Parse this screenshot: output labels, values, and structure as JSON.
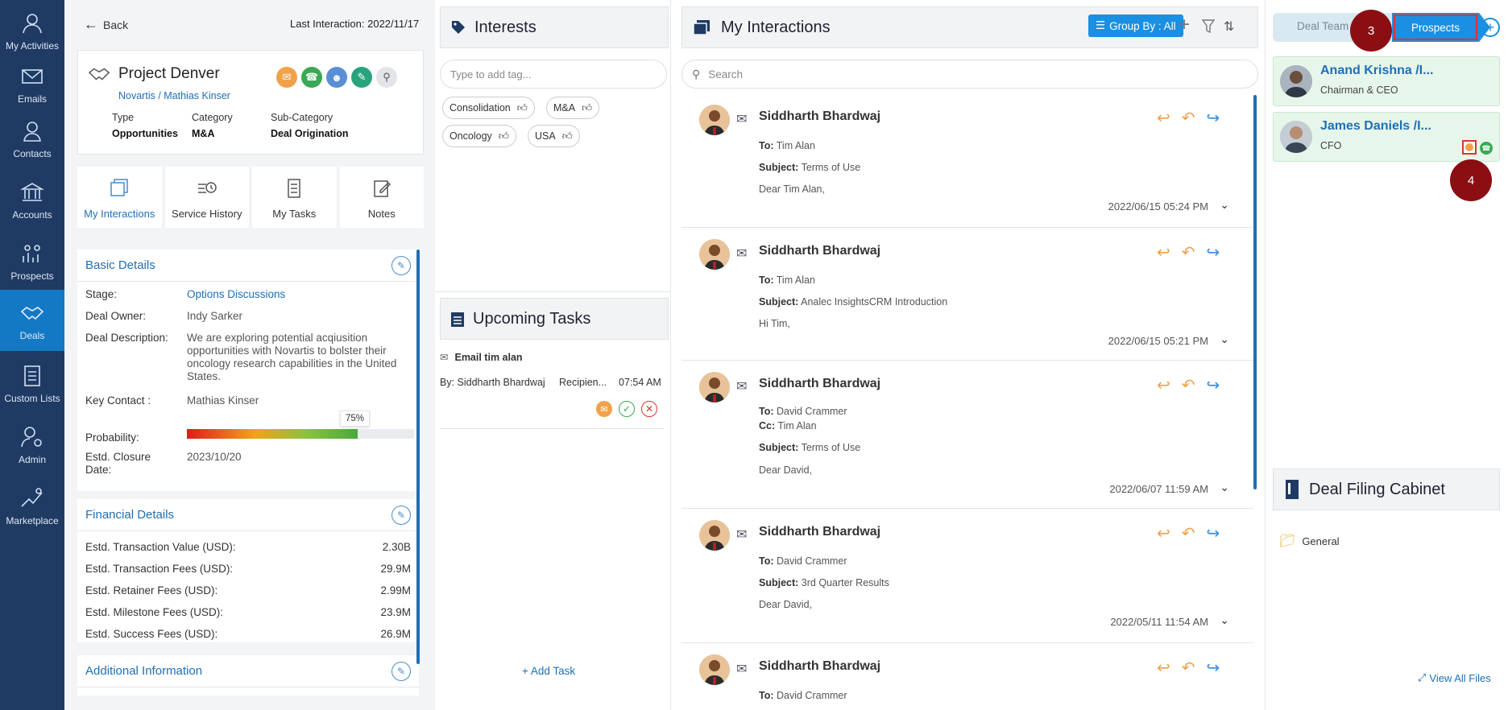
{
  "nav": [
    {
      "label": "My Activities",
      "icon": "user-icon"
    },
    {
      "label": "Emails",
      "icon": "mail-icon"
    },
    {
      "label": "Contacts",
      "icon": "contact-icon"
    },
    {
      "label": "Accounts",
      "icon": "bank-icon"
    },
    {
      "label": "Prospects",
      "icon": "prospects-icon"
    },
    {
      "label": "Deals",
      "icon": "handshake-icon",
      "active": true
    },
    {
      "label": "Custom Lists",
      "icon": "list-icon"
    },
    {
      "label": "Admin",
      "icon": "admin-icon"
    },
    {
      "label": "Marketplace",
      "icon": "marketplace-icon"
    }
  ],
  "header": {
    "back": "Back",
    "last_interaction": "Last Interaction: 2022/11/17"
  },
  "deal": {
    "title": "Project Denver",
    "subtitle": "Novartis / Mathias Kinser",
    "meta": {
      "type_label": "Type",
      "type_value": "Opportunities",
      "category_label": "Category",
      "category_value": "M&A",
      "subcategory_label": "Sub-Category",
      "subcategory_value": "Deal Origination"
    }
  },
  "tabs": [
    "My Interactions",
    "Service History",
    "My Tasks",
    "Notes"
  ],
  "basic": {
    "title": "Basic Details",
    "stage_label": "Stage:",
    "stage_value": "Options Discussions",
    "owner_label": "Deal Owner:",
    "owner_value": "Indy Sarker",
    "desc_label": "Deal Description:",
    "desc_value": "We are exploring potential acqiusition opportunities with Novartis to bolster their oncology research capabilities in the United States.",
    "contact_label": "Key Contact :",
    "contact_value": "Mathias Kinser",
    "prob_label": "Probability:",
    "prob_value": "75%",
    "prob_fraction": 0.75,
    "closure_label": "Estd. Closure Date:",
    "closure_value": "2023/10/20"
  },
  "financial": {
    "title": "Financial Details",
    "rows": [
      {
        "label": "Estd. Transaction Value (USD):",
        "value": "2.30B"
      },
      {
        "label": "Estd. Transaction Fees (USD):",
        "value": "29.9M"
      },
      {
        "label": "Estd. Retainer Fees (USD):",
        "value": "2.99M"
      },
      {
        "label": "Estd. Milestone Fees (USD):",
        "value": "23.9M"
      },
      {
        "label": "Estd. Success Fees (USD):",
        "value": "26.9M"
      }
    ]
  },
  "additional": {
    "title": "Additional Information"
  },
  "interests": {
    "title": "Interests",
    "placeholder": "Type to add tag...",
    "tags": [
      "Consolidation",
      "M&A",
      "Oncology",
      "USA"
    ]
  },
  "tasks": {
    "title": "Upcoming Tasks",
    "item_title": "Email tim alan",
    "item_by": "By: Siddharth Bhardwaj",
    "item_recipient": "Recipien...",
    "item_time": "07:54 AM",
    "add": "+ Add Task"
  },
  "interactions": {
    "title": "My Interactions",
    "group_by": "Group By : All",
    "search_placeholder": "Search",
    "items": [
      {
        "sender": "Siddharth Bhardwaj",
        "to": "Tim Alan",
        "cc": "",
        "subject": "Terms of Use",
        "body": "Dear Tim Alan,",
        "date": "2022/06/15 05:24 PM"
      },
      {
        "sender": "Siddharth Bhardwaj",
        "to": "Tim Alan",
        "cc": "",
        "subject": "Analec InsightsCRM Introduction",
        "body": "Hi Tim,",
        "date": "2022/06/15 05:21 PM"
      },
      {
        "sender": "Siddharth Bhardwaj",
        "to": "David Crammer",
        "cc": "Tim Alan",
        "subject": "Terms of Use",
        "body": "Dear David,",
        "date": "2022/06/07 11:59 AM"
      },
      {
        "sender": "Siddharth Bhardwaj",
        "to": "David Crammer",
        "cc": "",
        "subject": "3rd Quarter Results",
        "body": "Dear David,",
        "date": "2022/05/11 11:54 AM"
      },
      {
        "sender": "Siddharth Bhardwaj",
        "to": "David Crammer",
        "cc": "",
        "subject": "",
        "body": "",
        "date": ""
      }
    ],
    "to_label": "To:",
    "cc_label": "Cc:",
    "subject_label": "Subject:"
  },
  "prospects": {
    "tab_team": "Deal Team",
    "tab_prospects": "Prospects",
    "badge3": "3",
    "badge4": "4",
    "people": [
      {
        "name": "Anand Krishna /I...",
        "role": "Chairman & CEO"
      },
      {
        "name": "James Daniels /I...",
        "role": "CFO"
      }
    ]
  },
  "filing": {
    "title": "Deal Filing Cabinet",
    "folder": "General",
    "view_all": "View All Files"
  },
  "colors": {
    "nav_bg": "#1f3a63",
    "nav_active": "#1479c5",
    "accent": "#1b8fe2",
    "badge": "#8b0f12"
  }
}
